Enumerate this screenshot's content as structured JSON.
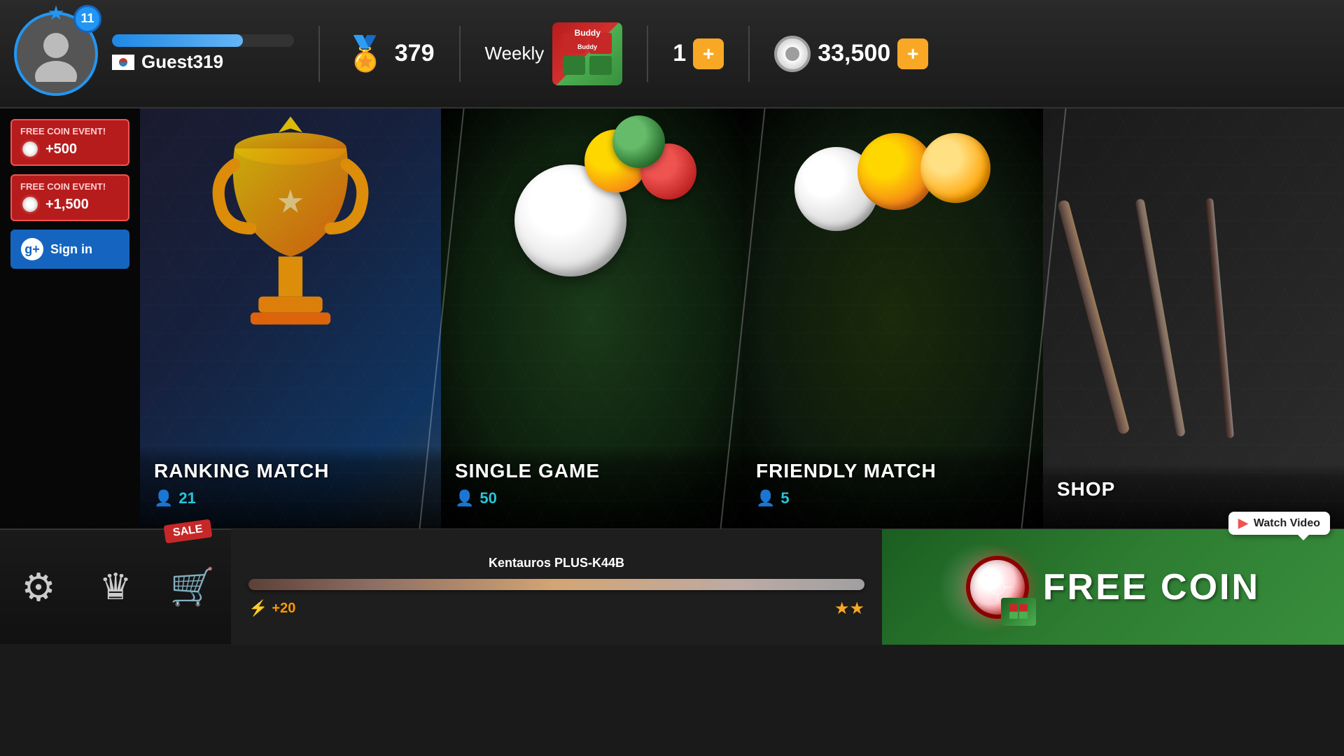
{
  "header": {
    "level": "11",
    "player_name": "Guest319",
    "xp_percent": 72,
    "rank_score": "379",
    "weekly_label": "Weekly",
    "ticket_count": "1",
    "coin_count": "33,500"
  },
  "sidebar": {
    "event1_title": "FREE COIN EVENT!",
    "event1_amount": "+500",
    "event2_title": "FREE COIN EVENT!",
    "event2_amount": "+1,500",
    "signin_label": "Sign in"
  },
  "panels": [
    {
      "id": "ranking-match",
      "title": "RANKING MATCH",
      "players": "21"
    },
    {
      "id": "single-game",
      "title": "SINGLE GAME",
      "players": "50"
    },
    {
      "id": "friendly-match",
      "title": "FRIENDLY MATCH",
      "players": "5"
    },
    {
      "id": "shop",
      "title": "SHOP",
      "players": null
    }
  ],
  "bottom": {
    "cue_name": "Kentauros PLUS-K44B",
    "cue_power": "+20",
    "cue_stars": "★★",
    "free_coin_label": "FREE COIN",
    "watch_video_label": "Watch Video",
    "sale_label": "SALE"
  },
  "icons": {
    "settings": "⚙",
    "crown": "♛",
    "cart": "🛒",
    "star": "★",
    "person": "👤",
    "lightning": "⚡",
    "play": "▶"
  }
}
